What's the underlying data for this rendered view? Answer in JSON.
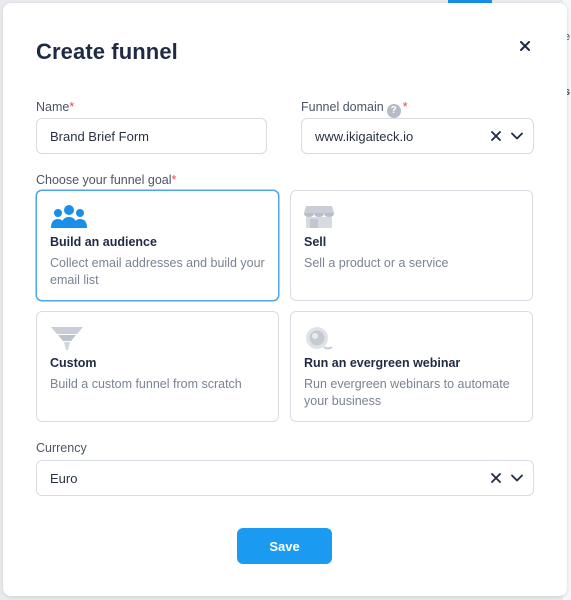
{
  "background": {
    "edge_glyph_top": "e",
    "edge_glyph_mid": "s"
  },
  "modal": {
    "title": "Create funnel",
    "close_icon": "close-icon"
  },
  "form": {
    "name": {
      "label": "Name",
      "required_mark": "*",
      "value": "Brand Brief Form"
    },
    "funnel_domain": {
      "label": "Funnel domain",
      "help_glyph": "?",
      "required_mark": "*",
      "value": "www.ikigaiteck.io"
    },
    "goal": {
      "label": "Choose your funnel goal",
      "required_mark": "*",
      "options": [
        {
          "title": "Build an audience",
          "description": "Collect email addresses and build your email list",
          "icon": "people-icon",
          "selected": true
        },
        {
          "title": "Sell",
          "description": "Sell a product or a service",
          "icon": "storefront-icon",
          "selected": false
        },
        {
          "title": "Custom",
          "description": "Build a custom funnel from scratch",
          "icon": "funnel-icon",
          "selected": false
        },
        {
          "title": "Run an evergreen webinar",
          "description": "Run evergreen webinars to automate your business",
          "icon": "webinar-icon",
          "selected": false
        }
      ]
    },
    "currency": {
      "label": "Currency",
      "value": "Euro"
    }
  },
  "actions": {
    "save_label": "Save"
  },
  "colors": {
    "accent": "#1a9af0",
    "selected_border": "#4ea6e6",
    "required": "#e5484d",
    "title": "#1f2a44",
    "muted_text": "#7a8392",
    "icon_inactive": "#c9ced6"
  }
}
